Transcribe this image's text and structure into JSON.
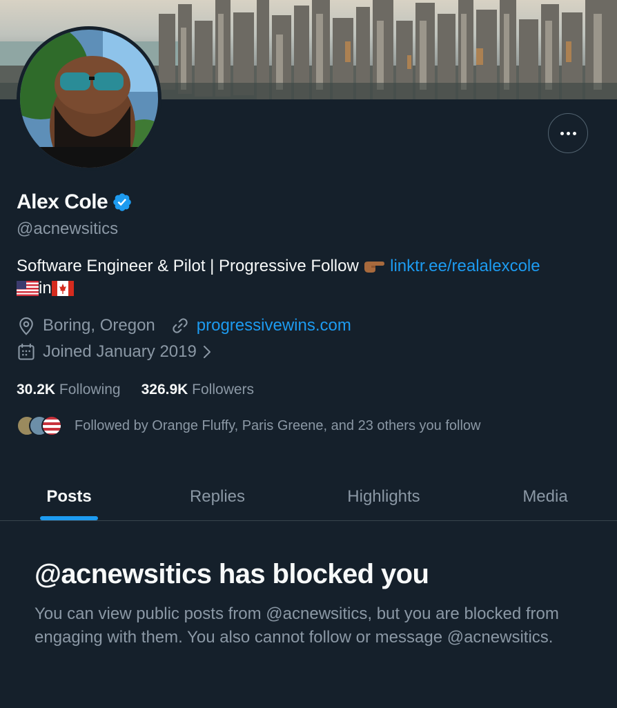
{
  "profile": {
    "name": "Alex Cole",
    "handle": "@acnewsitics",
    "bio_text": "Software Engineer & Pilot | Progressive Follow",
    "bio_link": "linktr.ee/realalexcole",
    "bio_in": "in",
    "location": "Boring, Oregon",
    "website": "progressivewins.com",
    "joined": "Joined January 2019",
    "following_count": "30.2K",
    "following_label": "Following",
    "followers_count": "326.9K",
    "followers_label": "Followers",
    "followed_by": "Followed by Orange Fluffy, Paris Greene, and 23 others you follow"
  },
  "icons": {
    "verified": "verified-badge-icon",
    "location": "location-pin-icon",
    "website": "link-icon",
    "joined": "calendar-icon",
    "more": "more-horizontal-icon"
  },
  "tabs": [
    {
      "label": "Posts",
      "active": true
    },
    {
      "label": "Replies",
      "active": false
    },
    {
      "label": "Highlights",
      "active": false
    },
    {
      "label": "Media",
      "active": false
    }
  ],
  "blocked": {
    "title": "@acnewsitics has blocked you",
    "body": "You can view public posts from @acnewsitics, but you are blocked from engaging with them. You also cannot follow or message @acnewsitics."
  },
  "colors": {
    "background": "#15202b",
    "accent": "#1d9bf0",
    "text_primary": "#f7f9f9",
    "text_secondary": "#8b98a5",
    "border": "#38444d"
  }
}
